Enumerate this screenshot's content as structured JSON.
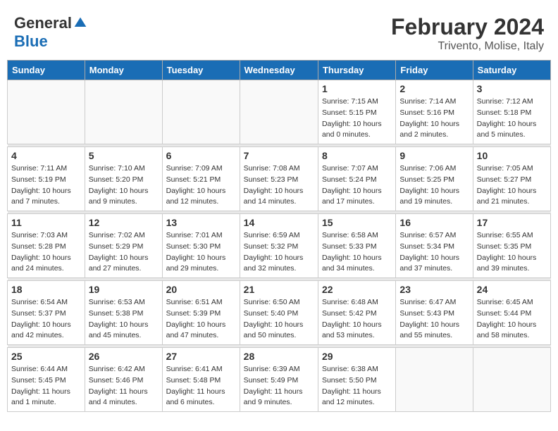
{
  "header": {
    "logo_general": "General",
    "logo_blue": "Blue",
    "title": "February 2024",
    "subtitle": "Trivento, Molise, Italy"
  },
  "days_of_week": [
    "Sunday",
    "Monday",
    "Tuesday",
    "Wednesday",
    "Thursday",
    "Friday",
    "Saturday"
  ],
  "weeks": [
    [
      {
        "day": "",
        "info": ""
      },
      {
        "day": "",
        "info": ""
      },
      {
        "day": "",
        "info": ""
      },
      {
        "day": "",
        "info": ""
      },
      {
        "day": "1",
        "info": "Sunrise: 7:15 AM\nSunset: 5:15 PM\nDaylight: 10 hours\nand 0 minutes."
      },
      {
        "day": "2",
        "info": "Sunrise: 7:14 AM\nSunset: 5:16 PM\nDaylight: 10 hours\nand 2 minutes."
      },
      {
        "day": "3",
        "info": "Sunrise: 7:12 AM\nSunset: 5:18 PM\nDaylight: 10 hours\nand 5 minutes."
      }
    ],
    [
      {
        "day": "4",
        "info": "Sunrise: 7:11 AM\nSunset: 5:19 PM\nDaylight: 10 hours\nand 7 minutes."
      },
      {
        "day": "5",
        "info": "Sunrise: 7:10 AM\nSunset: 5:20 PM\nDaylight: 10 hours\nand 9 minutes."
      },
      {
        "day": "6",
        "info": "Sunrise: 7:09 AM\nSunset: 5:21 PM\nDaylight: 10 hours\nand 12 minutes."
      },
      {
        "day": "7",
        "info": "Sunrise: 7:08 AM\nSunset: 5:23 PM\nDaylight: 10 hours\nand 14 minutes."
      },
      {
        "day": "8",
        "info": "Sunrise: 7:07 AM\nSunset: 5:24 PM\nDaylight: 10 hours\nand 17 minutes."
      },
      {
        "day": "9",
        "info": "Sunrise: 7:06 AM\nSunset: 5:25 PM\nDaylight: 10 hours\nand 19 minutes."
      },
      {
        "day": "10",
        "info": "Sunrise: 7:05 AM\nSunset: 5:27 PM\nDaylight: 10 hours\nand 21 minutes."
      }
    ],
    [
      {
        "day": "11",
        "info": "Sunrise: 7:03 AM\nSunset: 5:28 PM\nDaylight: 10 hours\nand 24 minutes."
      },
      {
        "day": "12",
        "info": "Sunrise: 7:02 AM\nSunset: 5:29 PM\nDaylight: 10 hours\nand 27 minutes."
      },
      {
        "day": "13",
        "info": "Sunrise: 7:01 AM\nSunset: 5:30 PM\nDaylight: 10 hours\nand 29 minutes."
      },
      {
        "day": "14",
        "info": "Sunrise: 6:59 AM\nSunset: 5:32 PM\nDaylight: 10 hours\nand 32 minutes."
      },
      {
        "day": "15",
        "info": "Sunrise: 6:58 AM\nSunset: 5:33 PM\nDaylight: 10 hours\nand 34 minutes."
      },
      {
        "day": "16",
        "info": "Sunrise: 6:57 AM\nSunset: 5:34 PM\nDaylight: 10 hours\nand 37 minutes."
      },
      {
        "day": "17",
        "info": "Sunrise: 6:55 AM\nSunset: 5:35 PM\nDaylight: 10 hours\nand 39 minutes."
      }
    ],
    [
      {
        "day": "18",
        "info": "Sunrise: 6:54 AM\nSunset: 5:37 PM\nDaylight: 10 hours\nand 42 minutes."
      },
      {
        "day": "19",
        "info": "Sunrise: 6:53 AM\nSunset: 5:38 PM\nDaylight: 10 hours\nand 45 minutes."
      },
      {
        "day": "20",
        "info": "Sunrise: 6:51 AM\nSunset: 5:39 PM\nDaylight: 10 hours\nand 47 minutes."
      },
      {
        "day": "21",
        "info": "Sunrise: 6:50 AM\nSunset: 5:40 PM\nDaylight: 10 hours\nand 50 minutes."
      },
      {
        "day": "22",
        "info": "Sunrise: 6:48 AM\nSunset: 5:42 PM\nDaylight: 10 hours\nand 53 minutes."
      },
      {
        "day": "23",
        "info": "Sunrise: 6:47 AM\nSunset: 5:43 PM\nDaylight: 10 hours\nand 55 minutes."
      },
      {
        "day": "24",
        "info": "Sunrise: 6:45 AM\nSunset: 5:44 PM\nDaylight: 10 hours\nand 58 minutes."
      }
    ],
    [
      {
        "day": "25",
        "info": "Sunrise: 6:44 AM\nSunset: 5:45 PM\nDaylight: 11 hours\nand 1 minute."
      },
      {
        "day": "26",
        "info": "Sunrise: 6:42 AM\nSunset: 5:46 PM\nDaylight: 11 hours\nand 4 minutes."
      },
      {
        "day": "27",
        "info": "Sunrise: 6:41 AM\nSunset: 5:48 PM\nDaylight: 11 hours\nand 6 minutes."
      },
      {
        "day": "28",
        "info": "Sunrise: 6:39 AM\nSunset: 5:49 PM\nDaylight: 11 hours\nand 9 minutes."
      },
      {
        "day": "29",
        "info": "Sunrise: 6:38 AM\nSunset: 5:50 PM\nDaylight: 11 hours\nand 12 minutes."
      },
      {
        "day": "",
        "info": ""
      },
      {
        "day": "",
        "info": ""
      }
    ]
  ]
}
